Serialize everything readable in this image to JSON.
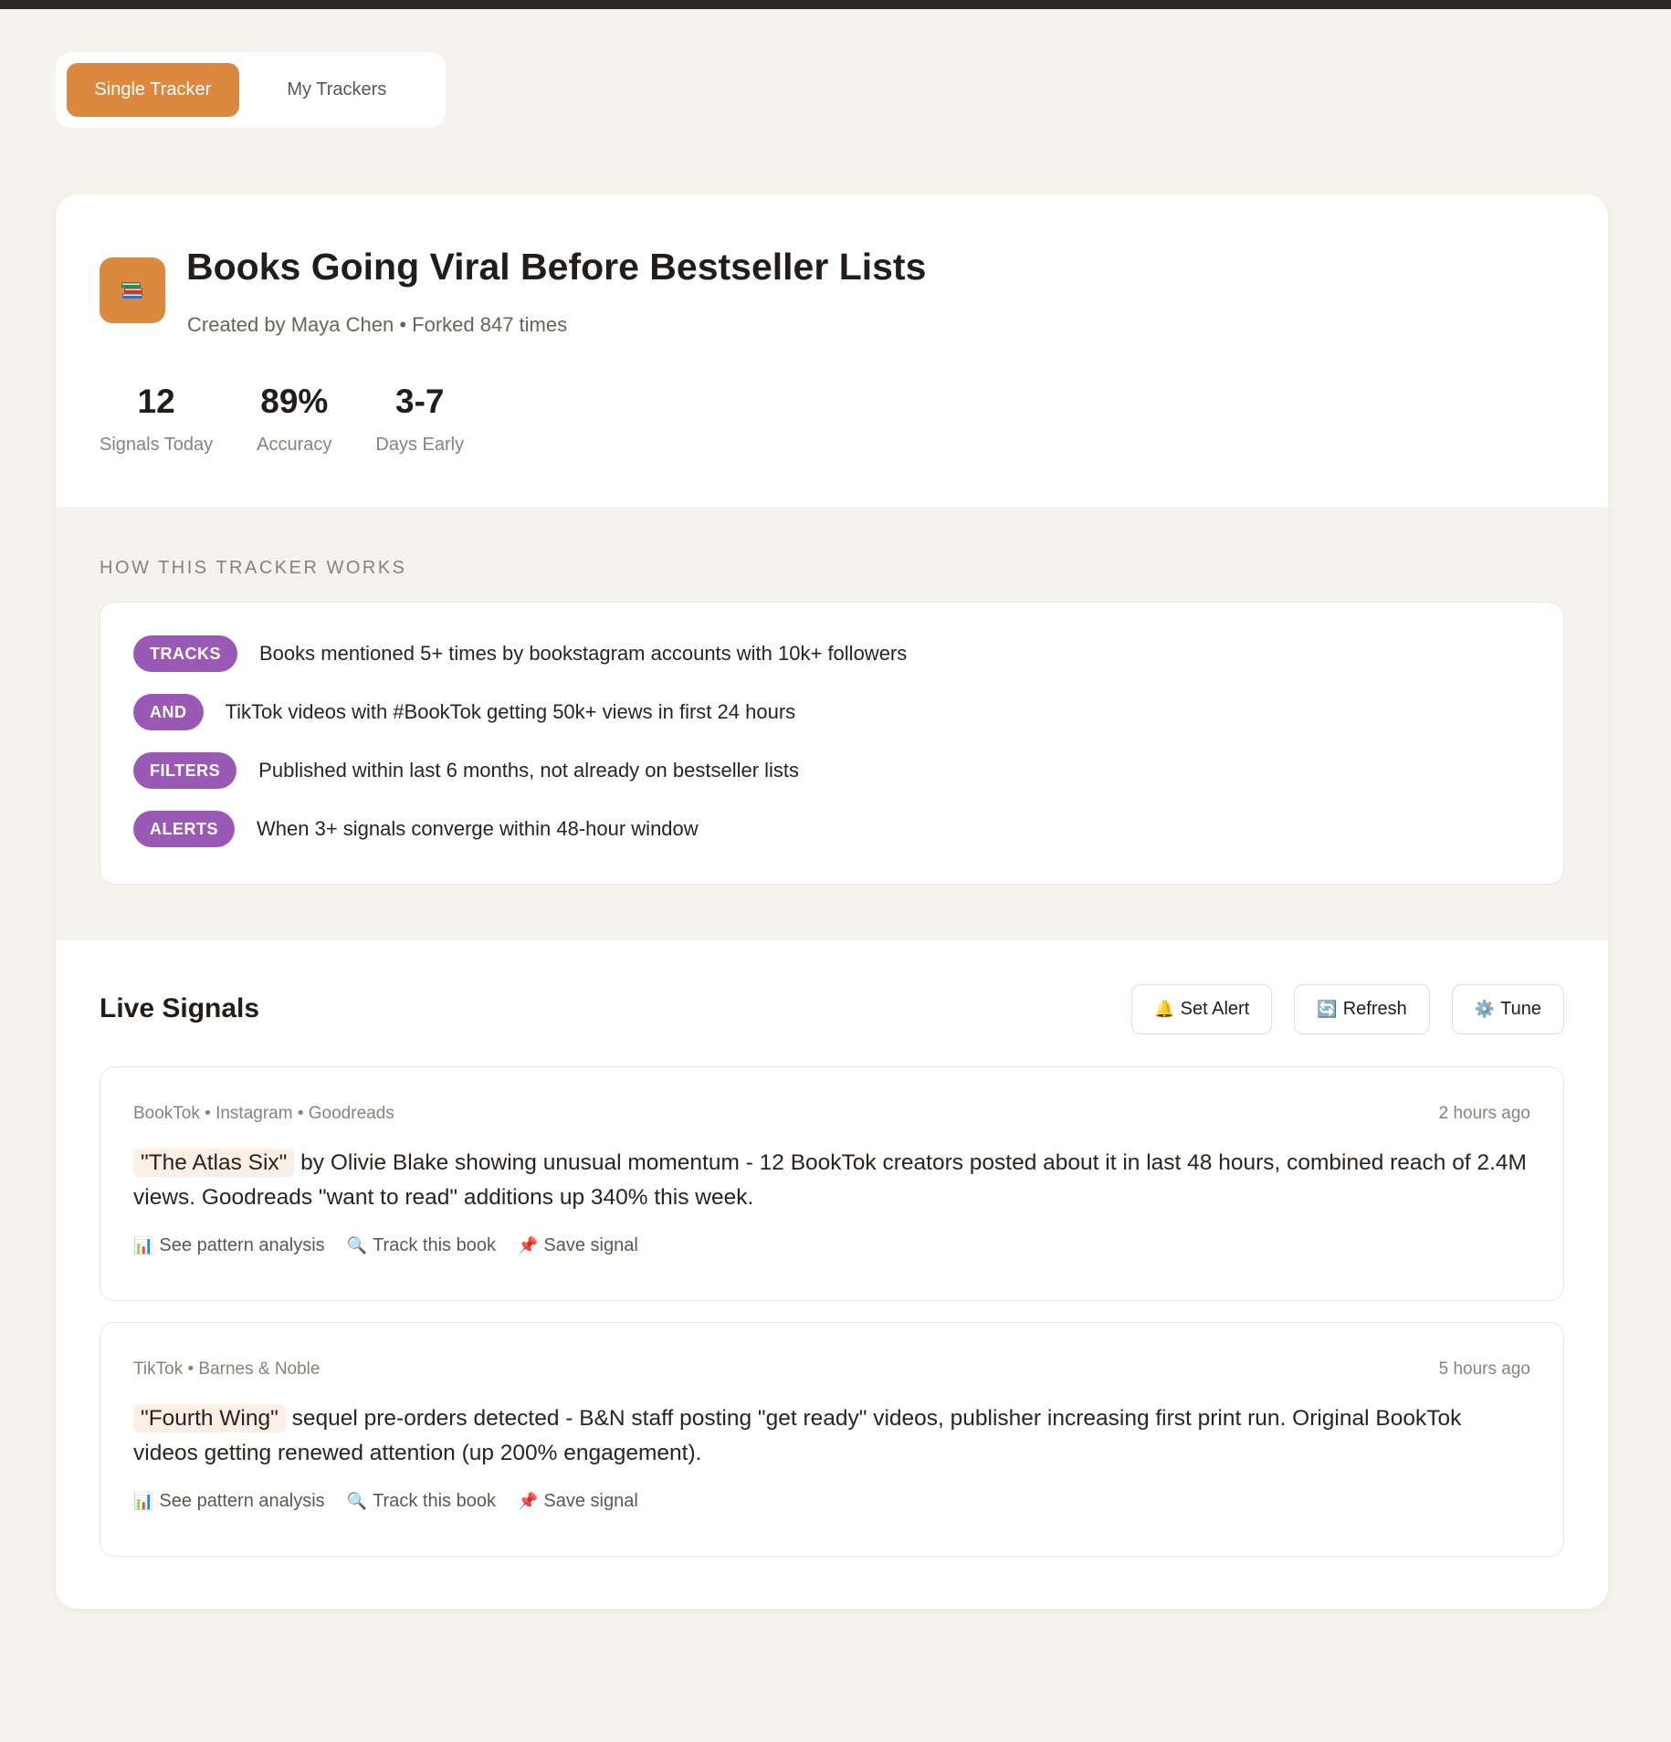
{
  "tabs": [
    {
      "label": "Single Tracker",
      "active": true
    },
    {
      "label": "My Trackers",
      "active": false
    }
  ],
  "tracker": {
    "icon": "books-icon",
    "title": "Books Going Viral Before Bestseller Lists",
    "subtitle": "Created by Maya Chen • Forked 847 times",
    "stats": [
      {
        "value": "12",
        "label": "Signals Today"
      },
      {
        "value": "89%",
        "label": "Accuracy"
      },
      {
        "value": "3-7",
        "label": "Days Early"
      }
    ]
  },
  "how": {
    "heading": "HOW THIS TRACKER WORKS",
    "rules": [
      {
        "tag": "TRACKS",
        "text": "Books mentioned 5+ times by bookstagram accounts with 10k+ followers"
      },
      {
        "tag": "AND",
        "text": "TikTok videos with #BookTok getting 50k+ views in first 24 hours"
      },
      {
        "tag": "FILTERS",
        "text": "Published within last 6 months, not already on bestseller lists"
      },
      {
        "tag": "ALERTS",
        "text": "When 3+ signals converge within 48-hour window"
      }
    ]
  },
  "signals": {
    "title": "Live Signals",
    "actions": [
      {
        "icon": "bell-icon",
        "glyph": "🔔",
        "label": "Set Alert"
      },
      {
        "icon": "refresh-icon",
        "glyph": "🔄",
        "label": "Refresh"
      },
      {
        "icon": "gear-icon",
        "glyph": "⚙️",
        "label": "Tune"
      }
    ],
    "items": [
      {
        "sources": "BookTok • Instagram • Goodreads",
        "time": "2 hours ago",
        "book": "\"The Atlas Six\"",
        "text": " by Olivie Blake showing unusual momentum - 12 BookTok creators posted about it in last 48 hours, combined reach of 2.4M views. Goodreads \"want to read\" additions up 340% this week.",
        "links": [
          {
            "glyph": "📊",
            "label": "See pattern analysis"
          },
          {
            "glyph": "🔍",
            "label": "Track this book"
          },
          {
            "glyph": "📌",
            "label": "Save signal"
          }
        ]
      },
      {
        "sources": "TikTok • Barnes & Noble",
        "time": "5 hours ago",
        "book": "\"Fourth Wing\"",
        "text": " sequel pre-orders detected - B&N staff posting \"get ready\" videos, publisher increasing first print run. Original BookTok videos getting renewed attention (up 200% engagement).",
        "links": [
          {
            "glyph": "📊",
            "label": "See pattern analysis"
          },
          {
            "glyph": "🔍",
            "label": "Track this book"
          },
          {
            "glyph": "📌",
            "label": "Save signal"
          }
        ]
      }
    ]
  },
  "colors": {
    "accent": "#dc883f",
    "tag": "#9b59b6",
    "background": "#f6f2ee"
  }
}
